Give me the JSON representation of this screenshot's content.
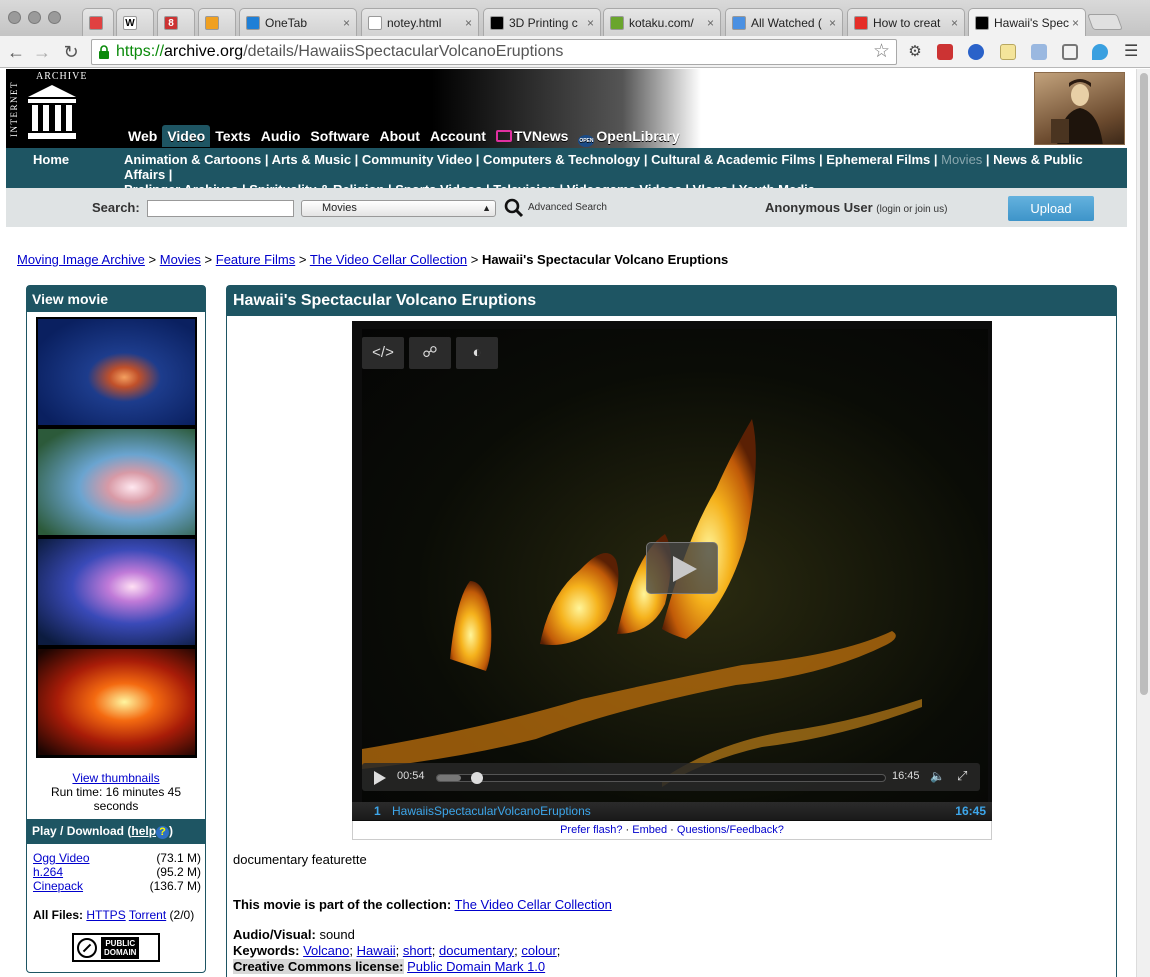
{
  "browser": {
    "tabs": [
      {
        "label": "",
        "icon": "gmail-icon-red",
        "color": "#e04040"
      },
      {
        "label": "W",
        "icon": "wikipedia-icon",
        "color": "#ffffff"
      },
      {
        "label": "8",
        "icon": "gmail-icon",
        "color": "#cc3333"
      },
      {
        "label": "",
        "icon": "orange-o-icon",
        "color": "#f0a020"
      },
      {
        "label": "OneTab",
        "icon": "onetab-icon",
        "color": "#1f7fd6"
      },
      {
        "label": "notey.html",
        "icon": "page-icon",
        "color": "#ffffff"
      },
      {
        "label": "3D Printing c",
        "icon": "skull-icon",
        "color": "#000000"
      },
      {
        "label": "kotaku.com/",
        "icon": "kotaku-icon",
        "color": "#6aa52d"
      },
      {
        "label": "All Watched (",
        "icon": "loading-icon",
        "color": "#4a90e2"
      },
      {
        "label": "How to creat",
        "icon": "youtube-icon",
        "color": "#e52d27"
      },
      {
        "label": "Hawaii's Spec",
        "icon": "archive-icon",
        "color": "#000000"
      }
    ],
    "url_scheme": "https://",
    "url_host": "archive.org",
    "url_path": "/details/HawaiisSpectacularVolcanoEruptions"
  },
  "ia": {
    "logo_vertical": "INTERNET",
    "logo_top": "ARCHIVE",
    "mainnav": [
      "Web",
      "Video",
      "Texts",
      "Audio",
      "Software",
      "About",
      "Account",
      "TVNews",
      "OpenLibrary"
    ],
    "openlibrary_badge": "OPEN",
    "home": "Home",
    "categories_line1": "Animation & Cartoons | Arts & Music | Community Video | Computers & Technology | Cultural & Academic Films | Ephemeral Films | ",
    "categories_current": "Movies",
    "categories_line1_end": " | News & Public Affairs |",
    "categories_line2": "Prelinger Archives | Spirituality & Religion | Sports Videos | Television | Videogame Videos | Vlogs | Youth Media",
    "search_label": "Search:",
    "search_value": "",
    "search_scope": "Movies",
    "advanced_search": "Advanced Search",
    "user": "Anonymous User",
    "login_join": "(login or join us)",
    "upload": "Upload"
  },
  "breadcrumb": {
    "items": [
      "Moving Image Archive",
      "Movies",
      "Feature Films",
      "The Video Cellar Collection"
    ],
    "separator": " > ",
    "current": "Hawaii's Spectacular Volcano Eruptions"
  },
  "left": {
    "view_movie": "View movie",
    "view_thumbnails": "View thumbnails",
    "runtime": "Run time: 16 minutes 45 seconds",
    "play_download": "Play / Download",
    "help": "help",
    "help_open": "(",
    "help_close": ")",
    "files": [
      {
        "name": "Ogg Video",
        "size": "(73.1 M)"
      },
      {
        "name": "h.264",
        "size": "(95.2 M)"
      },
      {
        "name": "Cinepack",
        "size": "(136.7 M)"
      }
    ],
    "all_files_label": "All Files:",
    "all_files_https": "HTTPS",
    "all_files_torrent": "Torrent",
    "all_files_count": "(2/0)",
    "badge_line1": "PUBLIC",
    "badge_line2": "DOMAIN"
  },
  "main": {
    "title": "Hawaii's Spectacular Volcano Eruptions",
    "player": {
      "current_time": "00:54",
      "duration": "16:45",
      "progress": 0.054,
      "playlist_index": "1",
      "playlist_name": "HawaiisSpectacularVolcanoEruptions",
      "playlist_duration": "16:45",
      "embed_icon": "</>",
      "links": [
        "Prefer flash?",
        "Embed",
        "Questions/Feedback?"
      ],
      "link_sep": " · "
    },
    "description": "documentary featurette",
    "collection_label": "This movie is part of the collection:",
    "collection_link": "The Video Cellar Collection",
    "av_label": "Audio/Visual:",
    "av_value": "sound",
    "keywords_label": "Keywords:",
    "keywords": [
      "Volcano",
      "Hawaii",
      "short",
      "documentary",
      "colour"
    ],
    "license_label": "Creative Commons license:",
    "license_link": "Public Domain Mark 1.0"
  }
}
